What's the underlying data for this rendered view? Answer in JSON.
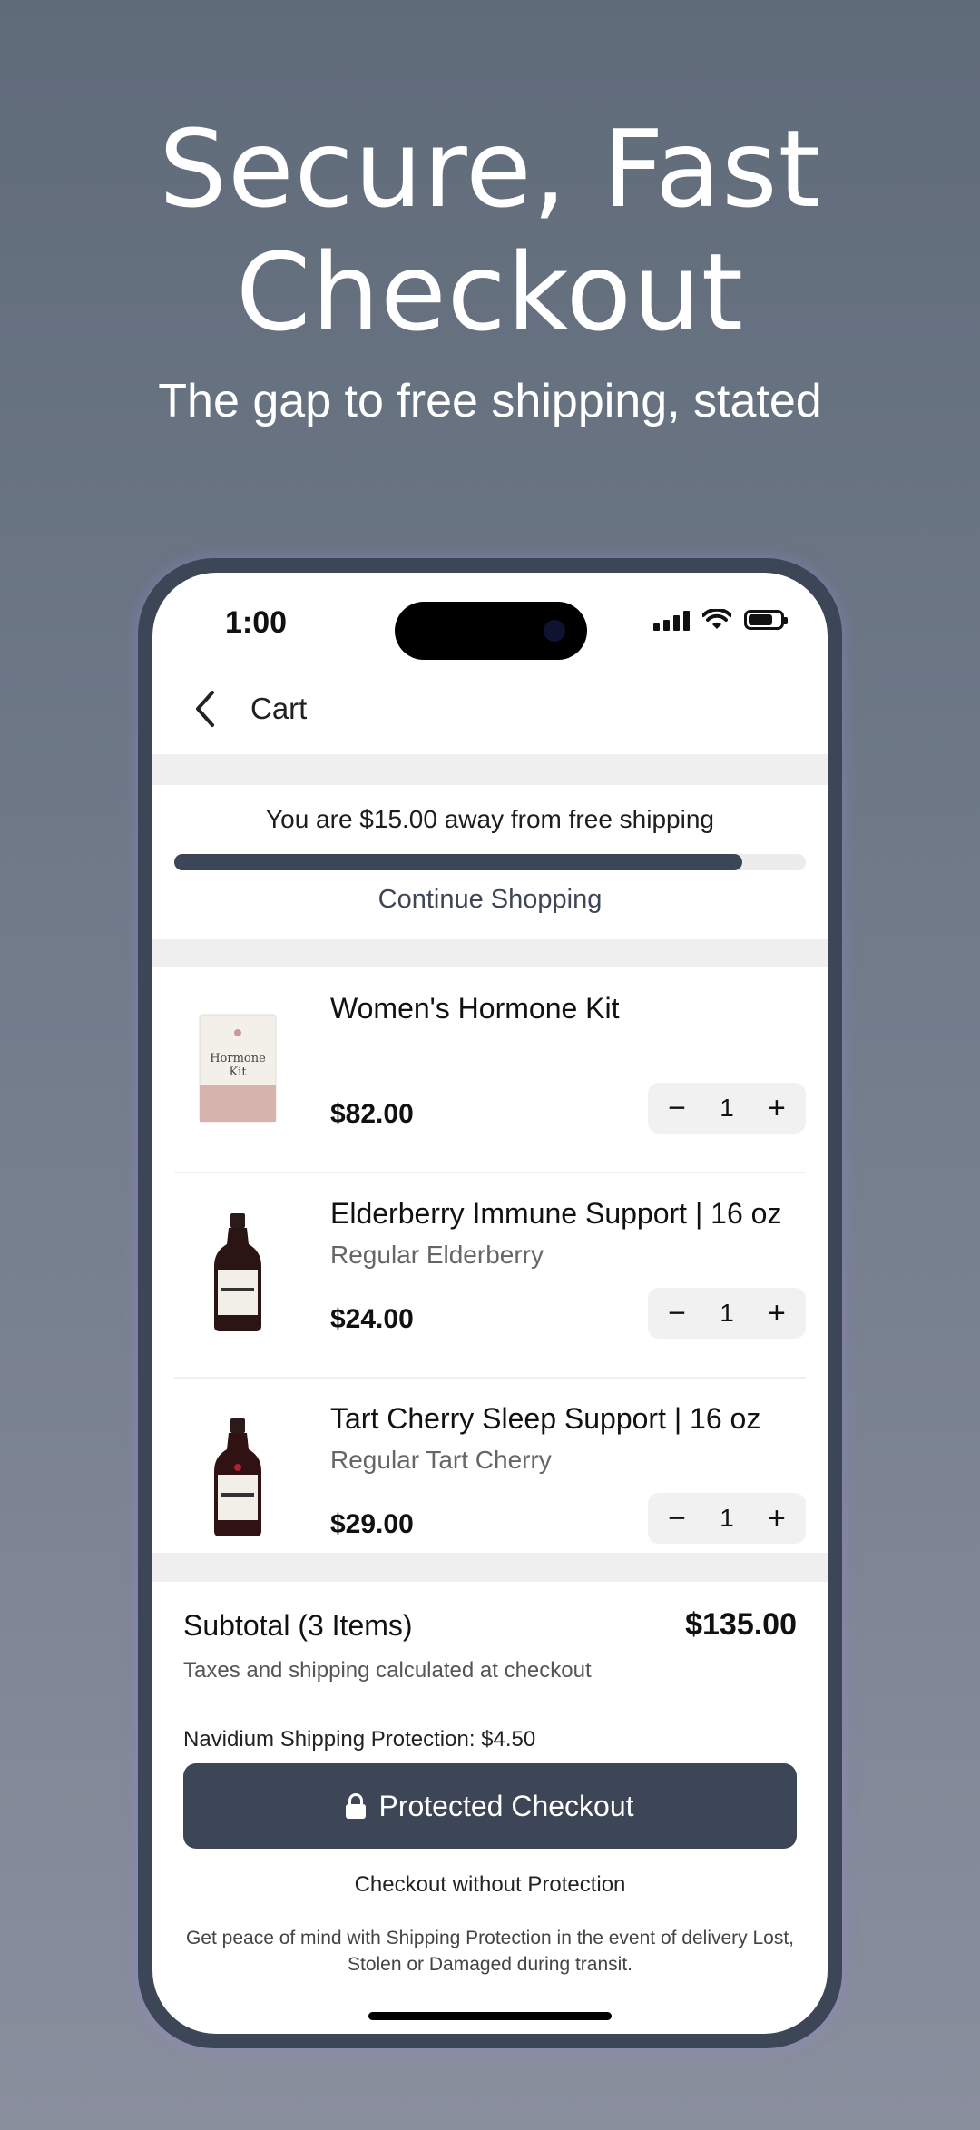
{
  "promo": {
    "headline": "Secure, Fast Checkout",
    "subheadline": "The gap to free shipping, stated"
  },
  "status_bar": {
    "time": "1:00"
  },
  "navbar": {
    "title": "Cart"
  },
  "shipping": {
    "message": "You are $15.00 away from free shipping",
    "progress_fraction": 0.9,
    "continue_label": "Continue Shopping"
  },
  "cart": {
    "items": [
      {
        "name": "Women's Hormone Kit",
        "variant": "",
        "price": "$82.00",
        "quantity": "1",
        "thumb_label_1": "Hormone",
        "thumb_label_2": "Kit"
      },
      {
        "name": "Elderberry Immune Support | 16 oz",
        "variant": "Regular Elderberry",
        "price": "$24.00",
        "quantity": "1"
      },
      {
        "name": "Tart Cherry Sleep Support | 16 oz",
        "variant": "Regular Tart Cherry",
        "price": "$29.00",
        "quantity": "1"
      }
    ]
  },
  "summary": {
    "subtotal_label": "Subtotal (3 Items)",
    "subtotal_value": "$135.00",
    "tax_note": "Taxes and shipping calculated at checkout",
    "protection_label": "Navidium Shipping Protection: $4.50",
    "checkout_label": "Protected Checkout",
    "no_protection_label": "Checkout without Protection",
    "disclaimer": "Get peace of mind with Shipping Protection in the event of delivery Lost, Stolen or Damaged during transit."
  },
  "stepper": {
    "minus": "−",
    "plus": "+"
  },
  "colors": {
    "accent": "#3d4656",
    "background_top": "#606b7a",
    "background_bottom": "#8a8f9e"
  },
  "icons": [
    "back-chevron-icon",
    "signal-icon",
    "wifi-icon",
    "battery-icon",
    "lock-icon",
    "minus-icon",
    "plus-icon"
  ]
}
